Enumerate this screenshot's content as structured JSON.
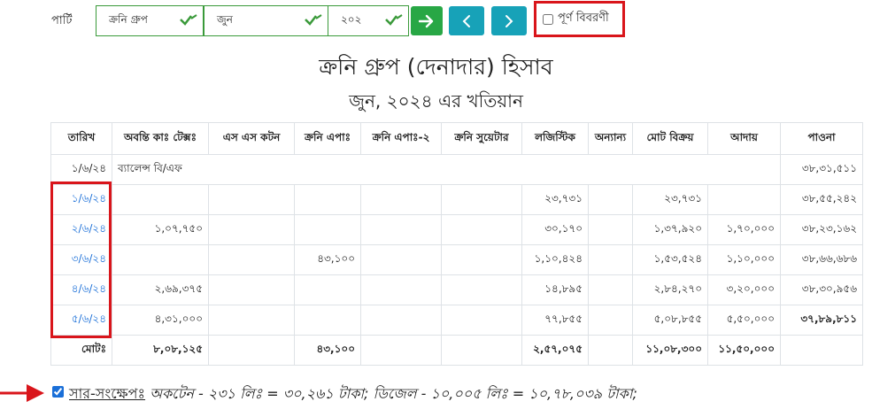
{
  "filter": {
    "party_label": "পার্টি",
    "party_value": "ক্রনি গ্রুপ",
    "month_value": "জুন",
    "year_value": "২০২",
    "full_details_label": "পূর্ণ বিবরণী",
    "full_details_checked": false
  },
  "colors": {
    "accent_green": "#28a745",
    "nav_teal": "#17a2b8",
    "link_blue": "#1a6fd8",
    "highlight_red": "#d9151b"
  },
  "header": {
    "title": "ক্রনি গ্রুপ (দেনাদার) হিসাব",
    "subtitle": "জুন, ২০২৪ এর খতিয়ান"
  },
  "table": {
    "columns": [
      "তারিখ",
      "অবন্তি কাঃ টেক্সঃ",
      "এস এস কটন",
      "ক্রনি এপাঃ",
      "ক্রনি এপাঃ-২",
      "ক্রনি সুয়েটার",
      "লজিস্টিক",
      "অন্যান্য",
      "মোট বিক্রয়",
      "আদায়",
      "পাওনা"
    ],
    "bf_row": {
      "date": "১/৬/২৪",
      "label": "ব্যালেন্স বি/এফ",
      "balance": "৩৮,৩১,৫১১"
    },
    "rows": [
      {
        "date": "১/৬/২৪",
        "c1": "",
        "c2": "",
        "c3": "",
        "c4": "",
        "c5": "",
        "c6": "২৩,৭৩১",
        "c7": "",
        "c8": "২৩,৭৩১",
        "c9": "",
        "c10": "৩৮,৫৫,২৪২"
      },
      {
        "date": "২/৬/২৪",
        "c1": "১,০৭,৭৫০",
        "c2": "",
        "c3": "",
        "c4": "",
        "c5": "",
        "c6": "৩০,১৭০",
        "c7": "",
        "c8": "১,৩৭,৯২০",
        "c9": "১,৭০,০০০",
        "c10": "৩৮,২৩,১৬২"
      },
      {
        "date": "৩/৬/২৪",
        "c1": "",
        "c2": "",
        "c3": "৪৩,১০০",
        "c4": "",
        "c5": "",
        "c6": "১,১০,৪২৪",
        "c7": "",
        "c8": "১,৫৩,৫২৪",
        "c9": "১,১০,০০০",
        "c10": "৩৮,৬৬,৬৮৬"
      },
      {
        "date": "৪/৬/২৪",
        "c1": "২,৬৯,৩৭৫",
        "c2": "",
        "c3": "",
        "c4": "",
        "c5": "",
        "c6": "১৪,৮৯৫",
        "c7": "",
        "c8": "২,৮৪,২৭০",
        "c9": "৩,২০,০০০",
        "c10": "৩৮,৩০,৯৫৬"
      },
      {
        "date": "৫/৬/২৪",
        "c1": "৪,৩১,০০০",
        "c2": "",
        "c3": "",
        "c4": "",
        "c5": "",
        "c6": "৭৭,৮৫৫",
        "c7": "",
        "c8": "৫,০৮,৮৫৫",
        "c9": "৫,৫০,০০০",
        "c10": "৩৭,৮৯,৮১১"
      }
    ],
    "total_row": {
      "label": "মোটঃ",
      "c1": "৮,০৮,১২৫",
      "c2": "",
      "c3": "৪৩,১০০",
      "c4": "",
      "c5": "",
      "c6": "২,৫৭,০৭৫",
      "c7": "",
      "c8": "১১,০৮,৩০০",
      "c9": "১১,৫০,০০০",
      "c10": ""
    }
  },
  "summary": {
    "checked": true,
    "label": "সার-সংক্ষেপঃ",
    "text": "অকটেন - ২৩১ লিঃ = ৩০,২৬১ টাকা; ডিজেল - ১০,০০৫ লিঃ = ১০,৭৮,০৩৯ টাকা;"
  }
}
